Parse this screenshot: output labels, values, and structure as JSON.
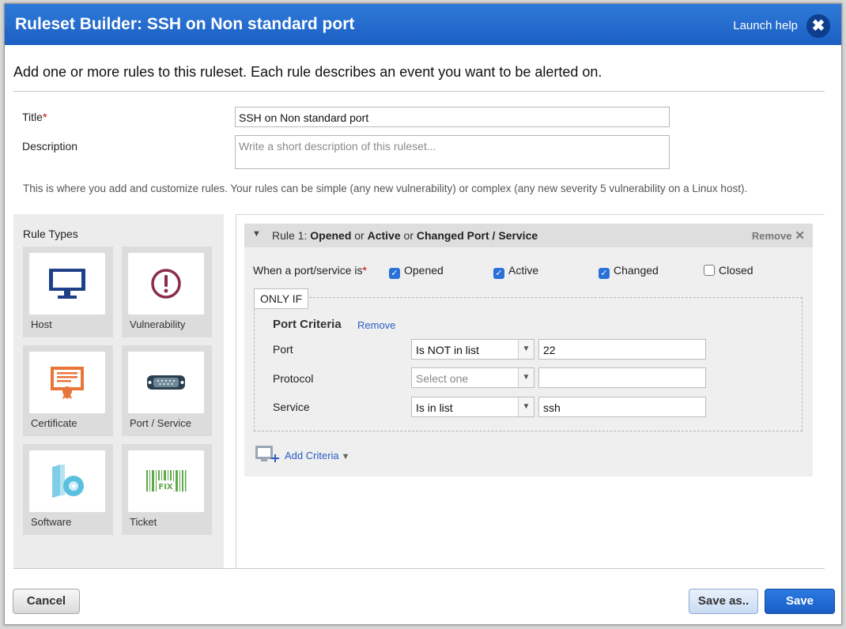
{
  "window": {
    "title": "Ruleset Builder: SSH on Non standard port",
    "help_label": "Launch help",
    "close_label": "✖"
  },
  "intro": "Add one or more rules to this ruleset. Each rule describes an event you want to be alerted on.",
  "form": {
    "title_label": "Title",
    "required_mark": "*",
    "title_value": "SSH on Non standard port",
    "description_label": "Description",
    "description_placeholder": "Write a short description of this ruleset..."
  },
  "hint": "This is where you add and customize rules. Your rules can be simple (any new vulnerability) or complex (any new severity 5 vulnerability on a Linux host).",
  "rule_types": {
    "heading": "Rule Types",
    "items": [
      {
        "label": "Host",
        "icon": "monitor-icon"
      },
      {
        "label": "Vulnerability",
        "icon": "exclamation-circle-icon"
      },
      {
        "label": "Certificate",
        "icon": "certificate-icon"
      },
      {
        "label": "Port / Service",
        "icon": "network-port-icon"
      },
      {
        "label": "Software",
        "icon": "software-disc-icon"
      },
      {
        "label": "Ticket",
        "icon": "ticket-fix-icon"
      }
    ]
  },
  "rule": {
    "prefix": "Rule 1: ",
    "part1": "Opened",
    "or1": " or ",
    "part2": "Active",
    "or2": " or ",
    "part3": "Changed Port / Service",
    "remove_label": "Remove",
    "when_label": "When a port/service is",
    "checkboxes": [
      {
        "label": "Opened",
        "checked": true
      },
      {
        "label": "Active",
        "checked": true
      },
      {
        "label": "Changed",
        "checked": true
      },
      {
        "label": "Closed",
        "checked": false
      }
    ],
    "only_if": "ONLY IF",
    "criteria_title": "Port Criteria",
    "criteria_remove": "Remove",
    "criteria": [
      {
        "label": "Port",
        "operator": "Is NOT in list",
        "value": "22"
      },
      {
        "label": "Protocol",
        "operator": "Select one",
        "value": ""
      },
      {
        "label": "Service",
        "operator": "Is in list",
        "value": "ssh"
      }
    ],
    "add_criteria": "Add Criteria"
  },
  "buttons": {
    "cancel": "Cancel",
    "save_as": "Save as..",
    "save": "Save"
  }
}
